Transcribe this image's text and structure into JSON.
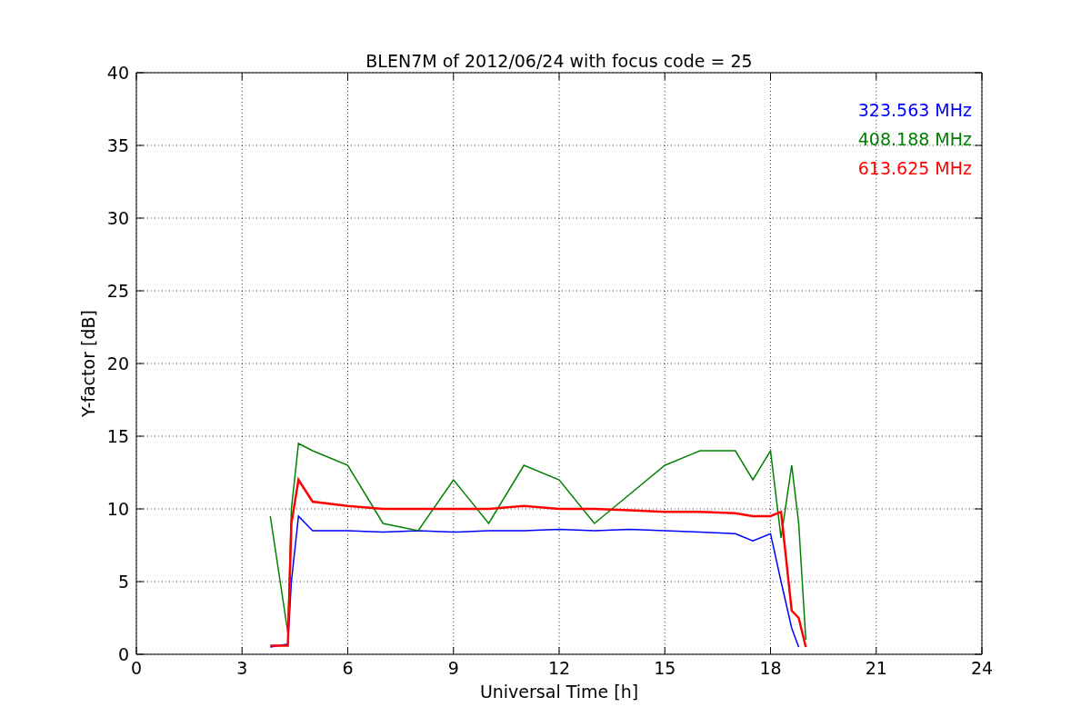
{
  "chart_data": {
    "type": "line",
    "title": "BLEN7M of 2012/06/24 with focus code = 25",
    "xlabel": "Universal Time [h]",
    "ylabel": "Y-factor [dB]",
    "x": [
      3.8,
      4.3,
      4.4,
      4.6,
      5,
      6,
      7,
      8,
      9,
      10,
      11,
      12,
      13,
      14,
      15,
      16,
      17,
      17.5,
      18,
      18.3,
      18.6,
      18.8,
      19
    ],
    "series": [
      {
        "name": "323.563 MHz",
        "color": "#0000ff",
        "values": [
          0.5,
          0.7,
          5,
          9.5,
          8.5,
          8.5,
          8.4,
          8.5,
          8.4,
          8.5,
          8.5,
          8.6,
          8.5,
          8.6,
          8.5,
          8.4,
          8.3,
          7.8,
          8.3,
          5,
          1.8,
          0.5,
          null
        ]
      },
      {
        "name": "408.188 MHz",
        "color": "#008000",
        "values": [
          9.5,
          1.5,
          10,
          14.5,
          14,
          13,
          9,
          8.5,
          12,
          9,
          13,
          12,
          9,
          11,
          13,
          14,
          14,
          12,
          14,
          8,
          13,
          9,
          1
        ]
      },
      {
        "name": "613.625 MHz",
        "color": "#ff0000",
        "values": [
          0.6,
          0.6,
          9,
          12,
          10.5,
          10.2,
          10,
          10,
          10,
          10,
          10.2,
          10,
          10,
          9.9,
          9.8,
          9.8,
          9.7,
          9.5,
          9.5,
          9.8,
          3,
          2.5,
          0.5
        ]
      }
    ],
    "grid": true,
    "xlim": [
      0,
      24
    ],
    "ylim": [
      0,
      40
    ],
    "xticks": [
      0,
      3,
      6,
      9,
      12,
      15,
      18,
      21,
      24
    ],
    "yticks": [
      0,
      5,
      10,
      15,
      20,
      25,
      30,
      35,
      40
    ]
  }
}
